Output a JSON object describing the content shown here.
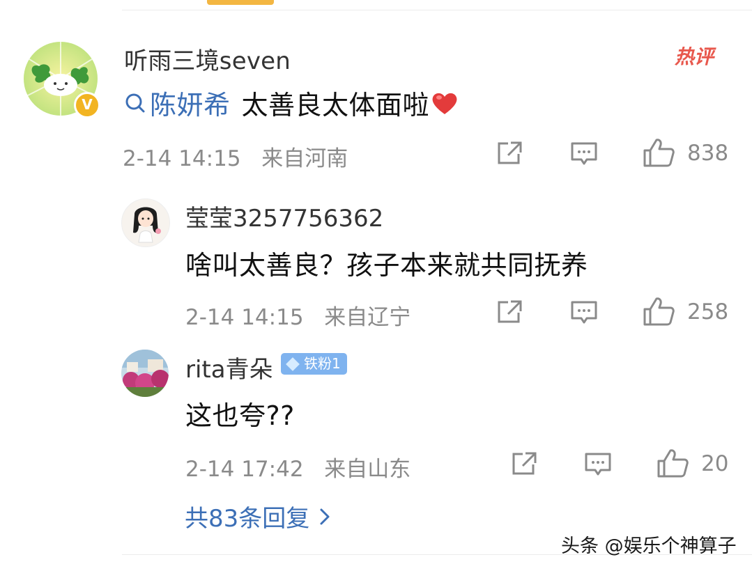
{
  "main_comment": {
    "username": "听雨三境seven",
    "hot_tag": "热评",
    "verified_mark": "V",
    "topic": "陈妍希",
    "text": "太善良太体面啦",
    "heart_icon": "red-heart-icon",
    "timestamp": "2-14 14:15",
    "location": "来自河南",
    "like_count": "838"
  },
  "replies": [
    {
      "username": "莹莹3257756362",
      "text": "啥叫太善良？孩子本来就共同抚养",
      "timestamp": "2-14 14:15",
      "location": "来自辽宁",
      "like_count": "258"
    },
    {
      "username": "rita青朵",
      "badge": "铁粉1",
      "text": "这也夸??",
      "timestamp": "2-14 17:42",
      "location": "来自山东",
      "like_count": "20"
    }
  ],
  "more_replies": {
    "label": "共83条回复",
    "icon": "chevron-right-icon"
  },
  "watermark": "头条 @娱乐个神算子",
  "colors": {
    "link_blue": "#3c6fb6",
    "meta_gray": "#8a8a8a",
    "hot_red": "#e8584d",
    "badge_blue": "#7fb3ef",
    "accent_bar": "#f3b642"
  }
}
